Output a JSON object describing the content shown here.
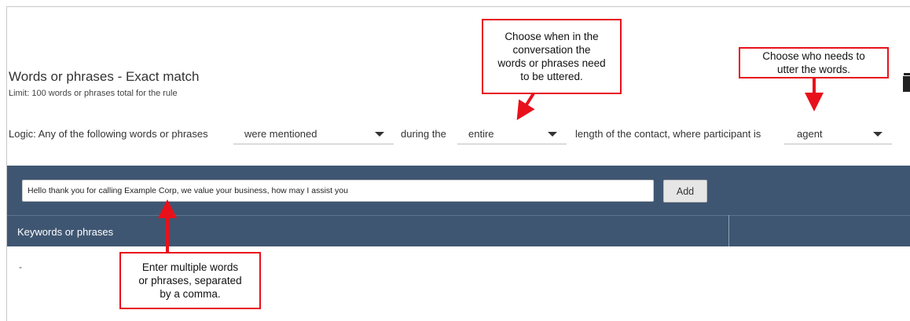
{
  "header": {
    "title": "Words or phrases - Exact match",
    "limit": "Limit: 100 words or phrases total for the rule"
  },
  "logic": {
    "prefix": "Logic: Any of the following words or phrases",
    "mention_select": "were mentioned",
    "during": "during the",
    "timing_select": "entire",
    "middle": "length of the contact, where participant is",
    "participant_select": "agent"
  },
  "phrases": {
    "input_value": "Hello thank you for calling Example Corp, we value your business, how may I assist you",
    "add_label": "Add",
    "column_header": "Keywords or phrases",
    "empty_value": "-"
  },
  "callouts": {
    "when": "Choose when in the\nconversation the\nwords or phrases need\nto be uttered.",
    "who": "Choose who needs to\nutter the words.",
    "enter": "Enter multiple words\nor phrases, separated\nby a comma."
  },
  "colors": {
    "panel": "#3f5672",
    "callout_border": "#e8111b"
  }
}
